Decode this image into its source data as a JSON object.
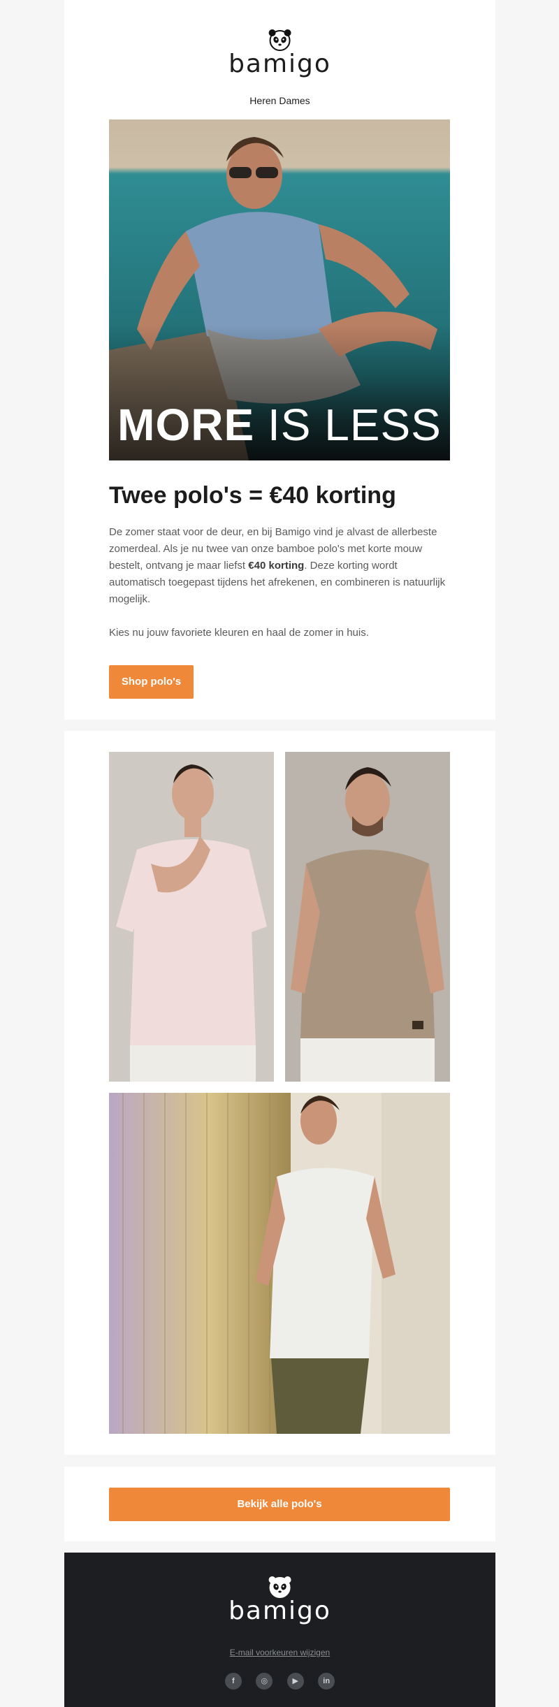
{
  "brand": {
    "name": "bamigo",
    "logo_icon": "panda-icon"
  },
  "nav": {
    "heren": "Heren",
    "dames": "Dames"
  },
  "hero": {
    "caption_bold": "MORE",
    "caption_light": "IS LESS",
    "headline": "Twee polo's = €40 korting",
    "paragraph_1_pre": "De zomer staat voor de deur, en bij Bamigo vind je alvast de allerbeste zomerdeal. Als je nu twee van onze bamboe polo's met korte mouw bestelt, ontvang je maar liefst ",
    "paragraph_1_bold": "€40 korting",
    "paragraph_1_post": ". Deze korting wordt automatisch toegepast tijdens het afrekenen, en combineren is natuurlijk mogelijk.",
    "paragraph_2": "Kies nu jouw favoriete kleuren en haal de zomer in huis.",
    "cta": "Shop polo's"
  },
  "gallery": {
    "items": [
      "pink-polo-photo",
      "taupe-polo-photo",
      "light-grey-polo-photo"
    ]
  },
  "cta_all": {
    "label": "Bekijk alle polo's"
  },
  "footer": {
    "preferences_link": "E-mail voorkeuren wijzigen",
    "socials": [
      {
        "icon": "facebook-icon",
        "glyph": "f"
      },
      {
        "icon": "instagram-icon",
        "glyph": "◎"
      },
      {
        "icon": "youtube-icon",
        "glyph": "▶"
      },
      {
        "icon": "linkedin-icon",
        "glyph": "in"
      }
    ]
  },
  "colors": {
    "accent": "#f0883a",
    "footer_bg": "#1c1e21",
    "page_bg": "#f6f6f6"
  }
}
